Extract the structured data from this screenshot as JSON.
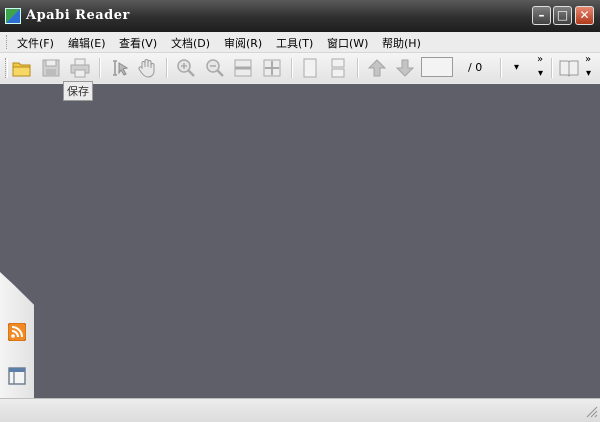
{
  "window": {
    "title": "Apabi Reader"
  },
  "titlebar_buttons": {
    "minimize": "–",
    "maximize": "□",
    "close": "✕"
  },
  "menu": {
    "items": [
      {
        "label": "文件(F)"
      },
      {
        "label": "编辑(E)"
      },
      {
        "label": "查看(V)"
      },
      {
        "label": "文档(D)"
      },
      {
        "label": "审阅(R)"
      },
      {
        "label": "工具(T)"
      },
      {
        "label": "窗口(W)"
      },
      {
        "label": "帮助(H)"
      }
    ]
  },
  "toolbar": {
    "page_input_value": "",
    "page_total": "/ 0",
    "more_glyph": "»",
    "dropdown_glyph": "▾",
    "icons": [
      "open-folder-icon",
      "save-icon",
      "print-icon",
      "select-text-icon",
      "hand-tool-icon",
      "zoom-in-icon",
      "zoom-out-icon",
      "fit-width-icon",
      "fit-page-icon",
      "single-page-icon",
      "continuous-page-icon",
      "previous-page-icon",
      "next-page-icon",
      "book-icon"
    ]
  },
  "tooltip": {
    "text": "保存"
  },
  "colors": {
    "document_background": "#5e5f69",
    "folder_icon": "#f2c744",
    "rss_icon": "#f08a24",
    "disabled_icon": "#b5b5b5"
  }
}
